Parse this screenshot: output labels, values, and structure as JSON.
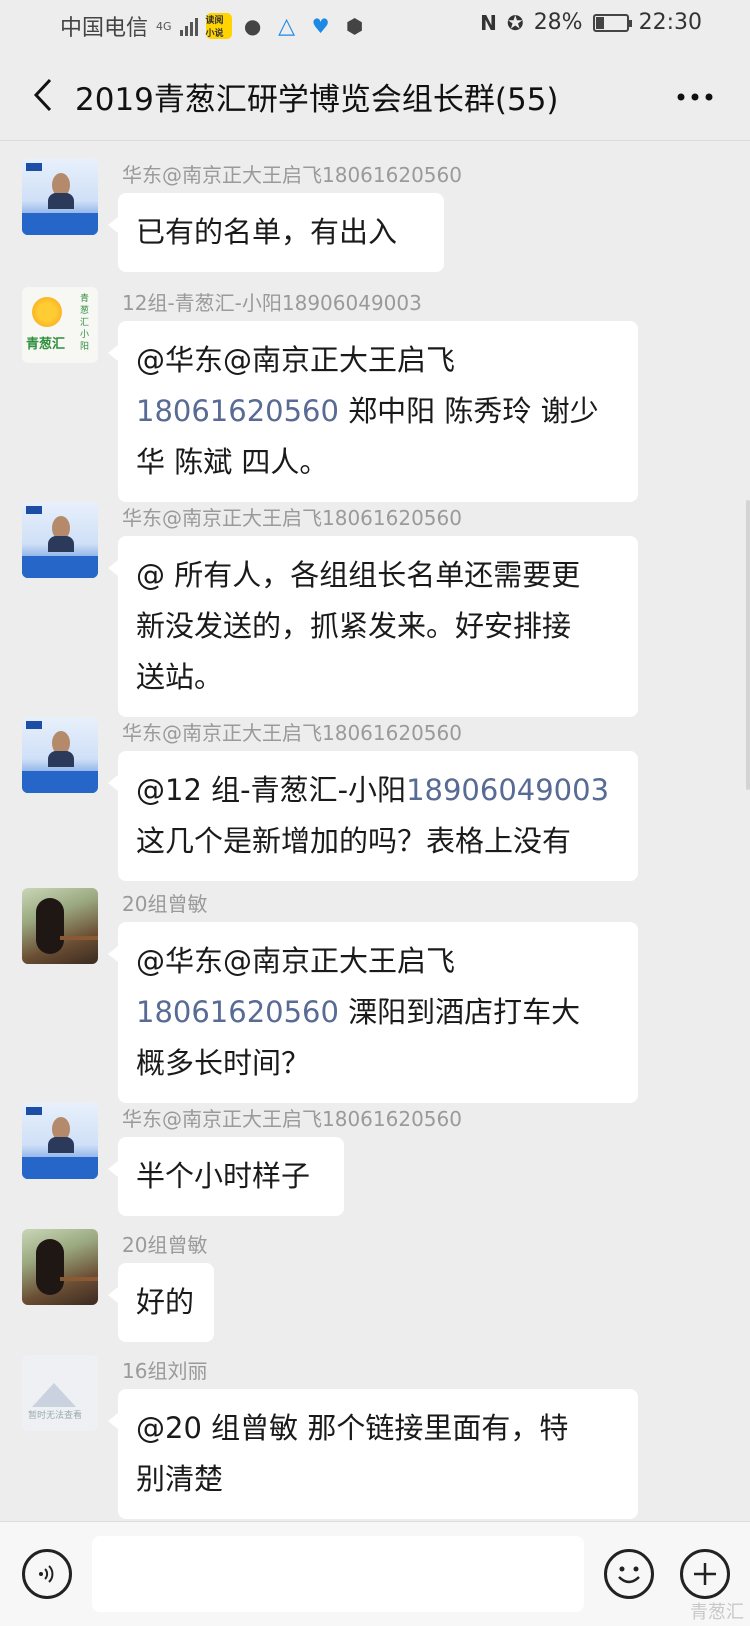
{
  "status_bar": {
    "carrier": "中国电信",
    "network": "4G",
    "app_icon_text": "读阅小说",
    "battery": "28%",
    "battery_level": 0.28,
    "time": "22:30"
  },
  "header": {
    "title": "2019青葱汇研学博览会组长群(55)"
  },
  "messages": [
    {
      "sender": "华东@南京正大王启飞18061620560",
      "avatar": "card",
      "lines": [
        [
          "已有的名单，有出入"
        ]
      ]
    },
    {
      "sender": "12组-青葱汇-小阳18906049003",
      "avatar": "sun",
      "lines": [
        [
          "@华东@南京正大王启飞"
        ],
        [
          "18061620560",
          " 郑中阳  陈秀玲  谢少"
        ],
        [
          "华  陈斌 四人。"
        ]
      ]
    },
    {
      "sender": "华东@南京正大王启飞18061620560",
      "avatar": "card",
      "lines": [
        [
          "@ 所有人，各组组长名单还需要更"
        ],
        [
          "新没发送的，抓紧发来。好安排接"
        ],
        [
          "送站。"
        ]
      ]
    },
    {
      "sender": "华东@南京正大王启飞18061620560",
      "avatar": "card",
      "lines": [
        [
          "@12 组-青葱汇-小阳",
          "18906049003"
        ],
        [
          "这几个是新增加的吗？表格上没有"
        ]
      ]
    },
    {
      "sender": "20组曾敏",
      "avatar": "photo",
      "lines": [
        [
          "@华东@南京正大王启飞"
        ],
        [
          "18061620560",
          "  溧阳到酒店打车大"
        ],
        [
          "概多长时间？"
        ]
      ]
    },
    {
      "sender": "华东@南京正大王启飞18061620560",
      "avatar": "card",
      "lines": [
        [
          "半个小时样子"
        ]
      ]
    },
    {
      "sender": "20组曾敏",
      "avatar": "photo",
      "lines": [
        [
          "好的"
        ]
      ]
    },
    {
      "sender": "16组刘丽",
      "avatar": "blank",
      "lines": [
        [
          "@20 组曾敏  那个链接里面有，特"
        ],
        [
          "别清楚"
        ]
      ]
    }
  ],
  "avatar_texts": {
    "sun_brand": "青葱汇",
    "sun_vertical": "青葱汇小阳",
    "blank_caption": "暂时无法查看"
  },
  "input_bar": {
    "placeholder": "",
    "watermark": "青葱汇"
  },
  "colors": {
    "background": "#ededed",
    "bubble": "#ffffff",
    "phone_link": "#586b94",
    "sender_gray": "#9a9a9a"
  }
}
